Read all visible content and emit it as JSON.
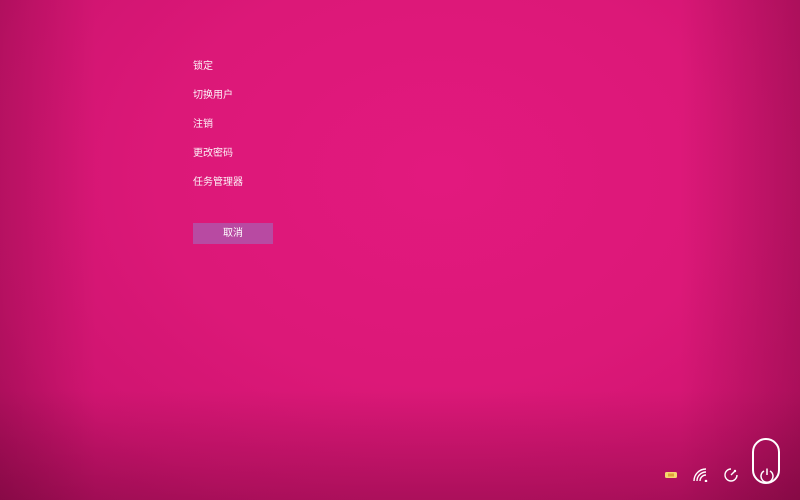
{
  "menu": {
    "items": [
      {
        "label": "锁定"
      },
      {
        "label": "切换用户"
      },
      {
        "label": "注销"
      },
      {
        "label": "更改密码"
      },
      {
        "label": "任务管理器"
      }
    ]
  },
  "cancel_label": "取消",
  "tray": {
    "icons": [
      "accessibility-icon",
      "network-icon",
      "ease-of-access-icon",
      "power-icon"
    ]
  },
  "colors": {
    "background": "#dc1878",
    "cancel_button": "#b84aa2",
    "text": "#ffffff"
  }
}
